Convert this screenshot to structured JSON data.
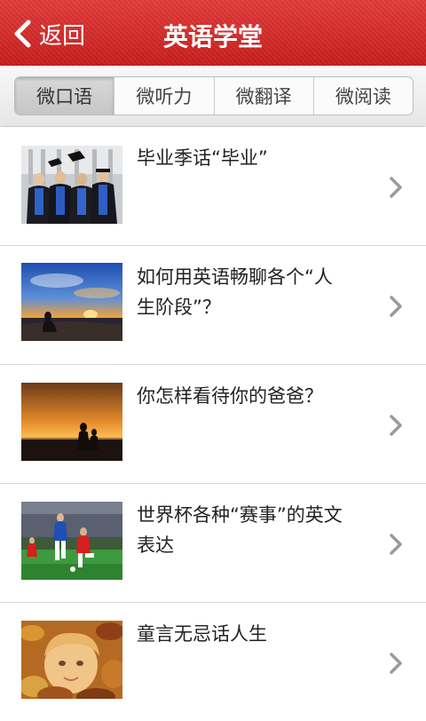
{
  "header": {
    "back_label": "返回",
    "title": "英语学堂"
  },
  "tabs": [
    {
      "label": "微口语",
      "active": true
    },
    {
      "label": "微听力",
      "active": false
    },
    {
      "label": "微翻译",
      "active": false
    },
    {
      "label": "微阅读",
      "active": false
    }
  ],
  "items": [
    {
      "title": "毕业季话“毕业”",
      "thumb_icon": "graduates-photo"
    },
    {
      "title": "如何用英语畅聊各个“人生阶段”？",
      "thumb_icon": "sunset-beach-photo"
    },
    {
      "title": "你怎样看待你的爸爸？",
      "thumb_icon": "father-son-sunset-photo"
    },
    {
      "title": "世界杯各种“赛事”的英文表达",
      "thumb_icon": "soccer-match-photo"
    },
    {
      "title": "童言无忌话人生",
      "thumb_icon": "child-autumn-leaves-photo"
    }
  ],
  "colors": {
    "header": "#d42727",
    "chevron": "#9a9a9a"
  }
}
